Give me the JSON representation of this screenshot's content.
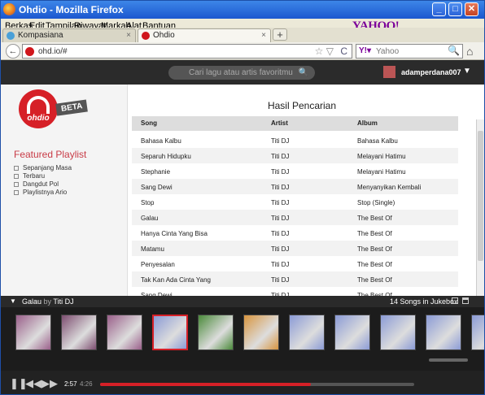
{
  "window": {
    "title": "Ohdio - Mozilla Firefox",
    "min": "_",
    "max": "□",
    "close": "✕"
  },
  "menu": [
    "Berkas",
    "Edit",
    "Tampilan",
    "Riwayat",
    "Markah",
    "Alat",
    "Bantuan"
  ],
  "yahoo_logo": "YAHOO!",
  "tabs": [
    {
      "label": "Kompasiana",
      "close": "×"
    },
    {
      "label": "Ohdio",
      "close": "×"
    }
  ],
  "newtab": "+",
  "nav": {
    "back": "←",
    "url": "ohd.io/#",
    "star": "☆ ▽",
    "reload": "C",
    "search_brand": "Y!▾",
    "search_placeholder": "Yahoo",
    "search_icon": "🔍",
    "home": "⌂"
  },
  "app": {
    "search_placeholder": "Cari lagu atau artis favoritmu",
    "search_icon": "🔍",
    "username": "adamperdana007",
    "caret": "▼",
    "logo_word": "ohdio",
    "beta": "BETA",
    "featured_title": "Featured Playlist",
    "playlists": [
      "Sepanjang Masa",
      "Terbaru",
      "Dangdut Pol",
      "Playlistnya Ario"
    ]
  },
  "results": {
    "title": "Hasil Pencarian",
    "columns": [
      "Song",
      "Artist",
      "Album"
    ],
    "rows": [
      [
        "Bahasa Kalbu",
        "Titi DJ",
        "Bahasa Kalbu"
      ],
      [
        "Separuh Hidupku",
        "Titi DJ",
        "Melayani Hatimu"
      ],
      [
        "Stephanie",
        "Titi DJ",
        "Melayani Hatimu"
      ],
      [
        "Sang Dewi",
        "Titi DJ",
        "Menyanyikan Kembali"
      ],
      [
        "Stop",
        "Titi DJ",
        "Stop (Single)"
      ],
      [
        "Galau",
        "Titi DJ",
        "The Best Of"
      ],
      [
        "Hanya Cinta Yang Bisa",
        "Titi DJ",
        "The Best Of"
      ],
      [
        "Matamu",
        "Titi DJ",
        "The Best Of"
      ],
      [
        "Penyesalan",
        "Titi DJ",
        "The Best Of"
      ],
      [
        "Tak Kan Ada Cinta Yang",
        "Titi DJ",
        "The Best Of"
      ],
      [
        "Sang Dewi",
        "Titi DJ",
        "The Best Of"
      ]
    ]
  },
  "player": {
    "now_song": "Galau",
    "by_word": "by",
    "now_artist": "Titi DJ",
    "songs_in_jukebox": "14 Songs in Jukebox",
    "caret": "▼",
    "elapsed": "2:57",
    "duration": "4:26",
    "progress": 0.67,
    "play_icon": "❚❚",
    "prev_icon": "◀◀",
    "next_icon": "▶▶",
    "thumb_colors": [
      "#9a5f8a",
      "#7d4d70",
      "#9a5f8a",
      "#8b9bd6",
      "#4a8a3a",
      "#d8953f",
      "#8b9bd6",
      "#8b9bd6",
      "#8b9bd6",
      "#8b9bd6",
      "#8b9bd6"
    ]
  }
}
